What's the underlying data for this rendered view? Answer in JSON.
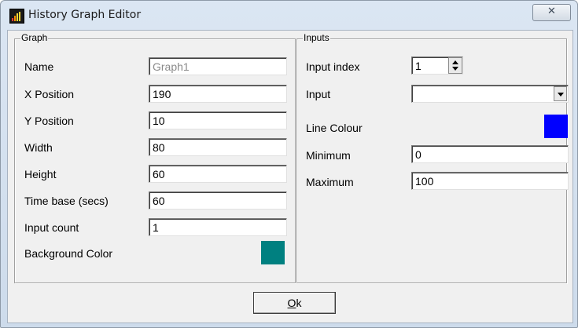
{
  "window": {
    "title": "History Graph Editor",
    "close_glyph": "✕"
  },
  "graph": {
    "group_title": "Graph",
    "fields": [
      {
        "label": "Name",
        "value": "Graph1"
      },
      {
        "label": "X Position",
        "value": "190"
      },
      {
        "label": "Y Position",
        "value": "10"
      },
      {
        "label": "Width",
        "value": "80"
      },
      {
        "label": "Height",
        "value": "60"
      },
      {
        "label": "Time base (secs)",
        "value": "60"
      },
      {
        "label": "Input count",
        "value": "1"
      }
    ],
    "background_color": {
      "label": "Background Color",
      "value": "#008080"
    }
  },
  "inputs": {
    "group_title": "Inputs",
    "input_index": {
      "label": "Input index",
      "value": "1"
    },
    "input": {
      "label": "Input",
      "value": ""
    },
    "line_colour": {
      "label": "Line Colour",
      "value": "#0000ff"
    },
    "minimum": {
      "label": "Minimum",
      "value": "0"
    },
    "maximum": {
      "label": "Maximum",
      "value": "100"
    }
  },
  "buttons": {
    "ok_mnemonic": "O",
    "ok_rest": "k"
  }
}
